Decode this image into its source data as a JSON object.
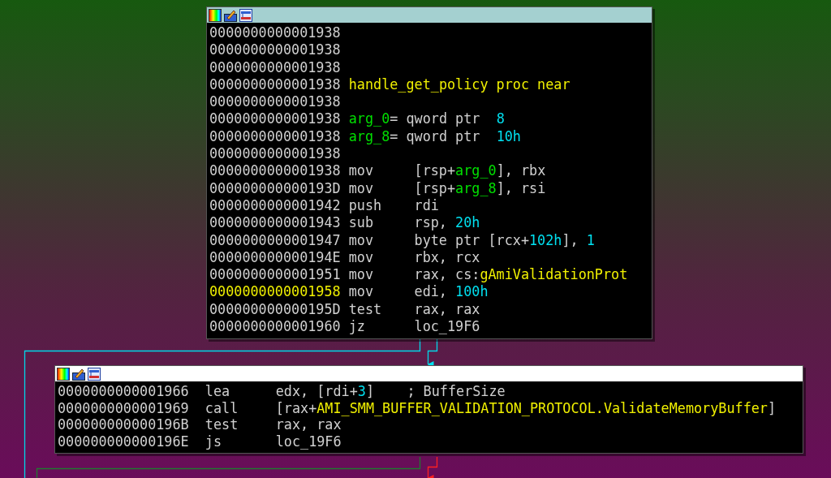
{
  "nodes": [
    {
      "selected": true,
      "lines": [
        {
          "address": "0000000000001938",
          "current": false
        },
        {
          "address": "0000000000001938",
          "current": false
        },
        {
          "address": "0000000000001938",
          "current": false
        },
        {
          "address": "0000000000001938",
          "current": false,
          "operands": [
            {
              "text": "handle_get_policy proc near",
              "kind": "name"
            }
          ]
        },
        {
          "address": "0000000000001938",
          "current": false
        },
        {
          "address": "0000000000001938",
          "current": false,
          "operands": [
            {
              "text": "arg_0",
              "kind": "var"
            },
            {
              "text": "= qword ptr  ",
              "kind": "plain"
            },
            {
              "text": "8",
              "kind": "num"
            }
          ]
        },
        {
          "address": "0000000000001938",
          "current": false,
          "operands": [
            {
              "text": "arg_8",
              "kind": "var"
            },
            {
              "text": "= qword ptr  ",
              "kind": "plain"
            },
            {
              "text": "10h",
              "kind": "num"
            }
          ]
        },
        {
          "address": "0000000000001938",
          "current": false
        },
        {
          "address": "0000000000001938",
          "current": false,
          "mnemonic": "mov",
          "operands": [
            {
              "text": "[rsp+",
              "kind": "plain"
            },
            {
              "text": "arg_0",
              "kind": "var"
            },
            {
              "text": "], rbx",
              "kind": "plain"
            }
          ]
        },
        {
          "address": "000000000000193D",
          "current": false,
          "mnemonic": "mov",
          "operands": [
            {
              "text": "[rsp+",
              "kind": "plain"
            },
            {
              "text": "arg_8",
              "kind": "var"
            },
            {
              "text": "], rsi",
              "kind": "plain"
            }
          ]
        },
        {
          "address": "0000000000001942",
          "current": false,
          "mnemonic": "push",
          "operands": [
            {
              "text": "rdi",
              "kind": "plain"
            }
          ]
        },
        {
          "address": "0000000000001943",
          "current": false,
          "mnemonic": "sub",
          "operands": [
            {
              "text": "rsp, ",
              "kind": "plain"
            },
            {
              "text": "20h",
              "kind": "num"
            }
          ]
        },
        {
          "address": "0000000000001947",
          "current": false,
          "mnemonic": "mov",
          "operands": [
            {
              "text": "byte ptr [rcx+",
              "kind": "plain"
            },
            {
              "text": "102h",
              "kind": "num"
            },
            {
              "text": "], ",
              "kind": "plain"
            },
            {
              "text": "1",
              "kind": "num"
            }
          ]
        },
        {
          "address": "000000000000194E",
          "current": false,
          "mnemonic": "mov",
          "operands": [
            {
              "text": "rbx, rcx",
              "kind": "plain"
            }
          ]
        },
        {
          "address": "0000000000001951",
          "current": false,
          "mnemonic": "mov",
          "operands": [
            {
              "text": "rax, cs:",
              "kind": "plain"
            },
            {
              "text": "gAmiValidationProt",
              "kind": "name"
            }
          ]
        },
        {
          "address": "0000000000001958",
          "current": true,
          "mnemonic": "mov",
          "operands": [
            {
              "text": "edi, ",
              "kind": "plain"
            },
            {
              "text": "100h",
              "kind": "num"
            }
          ]
        },
        {
          "address": "000000000000195D",
          "current": false,
          "mnemonic": "test",
          "operands": [
            {
              "text": "rax, rax",
              "kind": "plain"
            }
          ]
        },
        {
          "address": "0000000000001960",
          "current": false,
          "mnemonic": "jz",
          "operands": [
            {
              "text": "loc_19F6",
              "kind": "plain"
            }
          ]
        }
      ]
    },
    {
      "selected": false,
      "lines": [
        {
          "address": "0000000000001966",
          "current": false,
          "mnemonic": "lea",
          "operands": [
            {
              "text": "edx, [rdi+",
              "kind": "plain"
            },
            {
              "text": "3",
              "kind": "num"
            },
            {
              "text": "]    ; BufferSize",
              "kind": "plain"
            }
          ]
        },
        {
          "address": "0000000000001969",
          "current": false,
          "mnemonic": "call",
          "operands": [
            {
              "text": "[rax+",
              "kind": "plain"
            },
            {
              "text": "AMI_SMM_BUFFER_VALIDATION_PROTOCOL.ValidateMemoryBuffer",
              "kind": "name"
            },
            {
              "text": "]",
              "kind": "plain"
            }
          ]
        },
        {
          "address": "000000000000196B",
          "current": false,
          "mnemonic": "test",
          "operands": [
            {
              "text": "rax, rax",
              "kind": "plain"
            }
          ]
        },
        {
          "address": "000000000000196E",
          "current": false,
          "mnemonic": "js",
          "operands": [
            {
              "text": "loc_19F6",
              "kind": "plain"
            }
          ]
        }
      ]
    }
  ]
}
